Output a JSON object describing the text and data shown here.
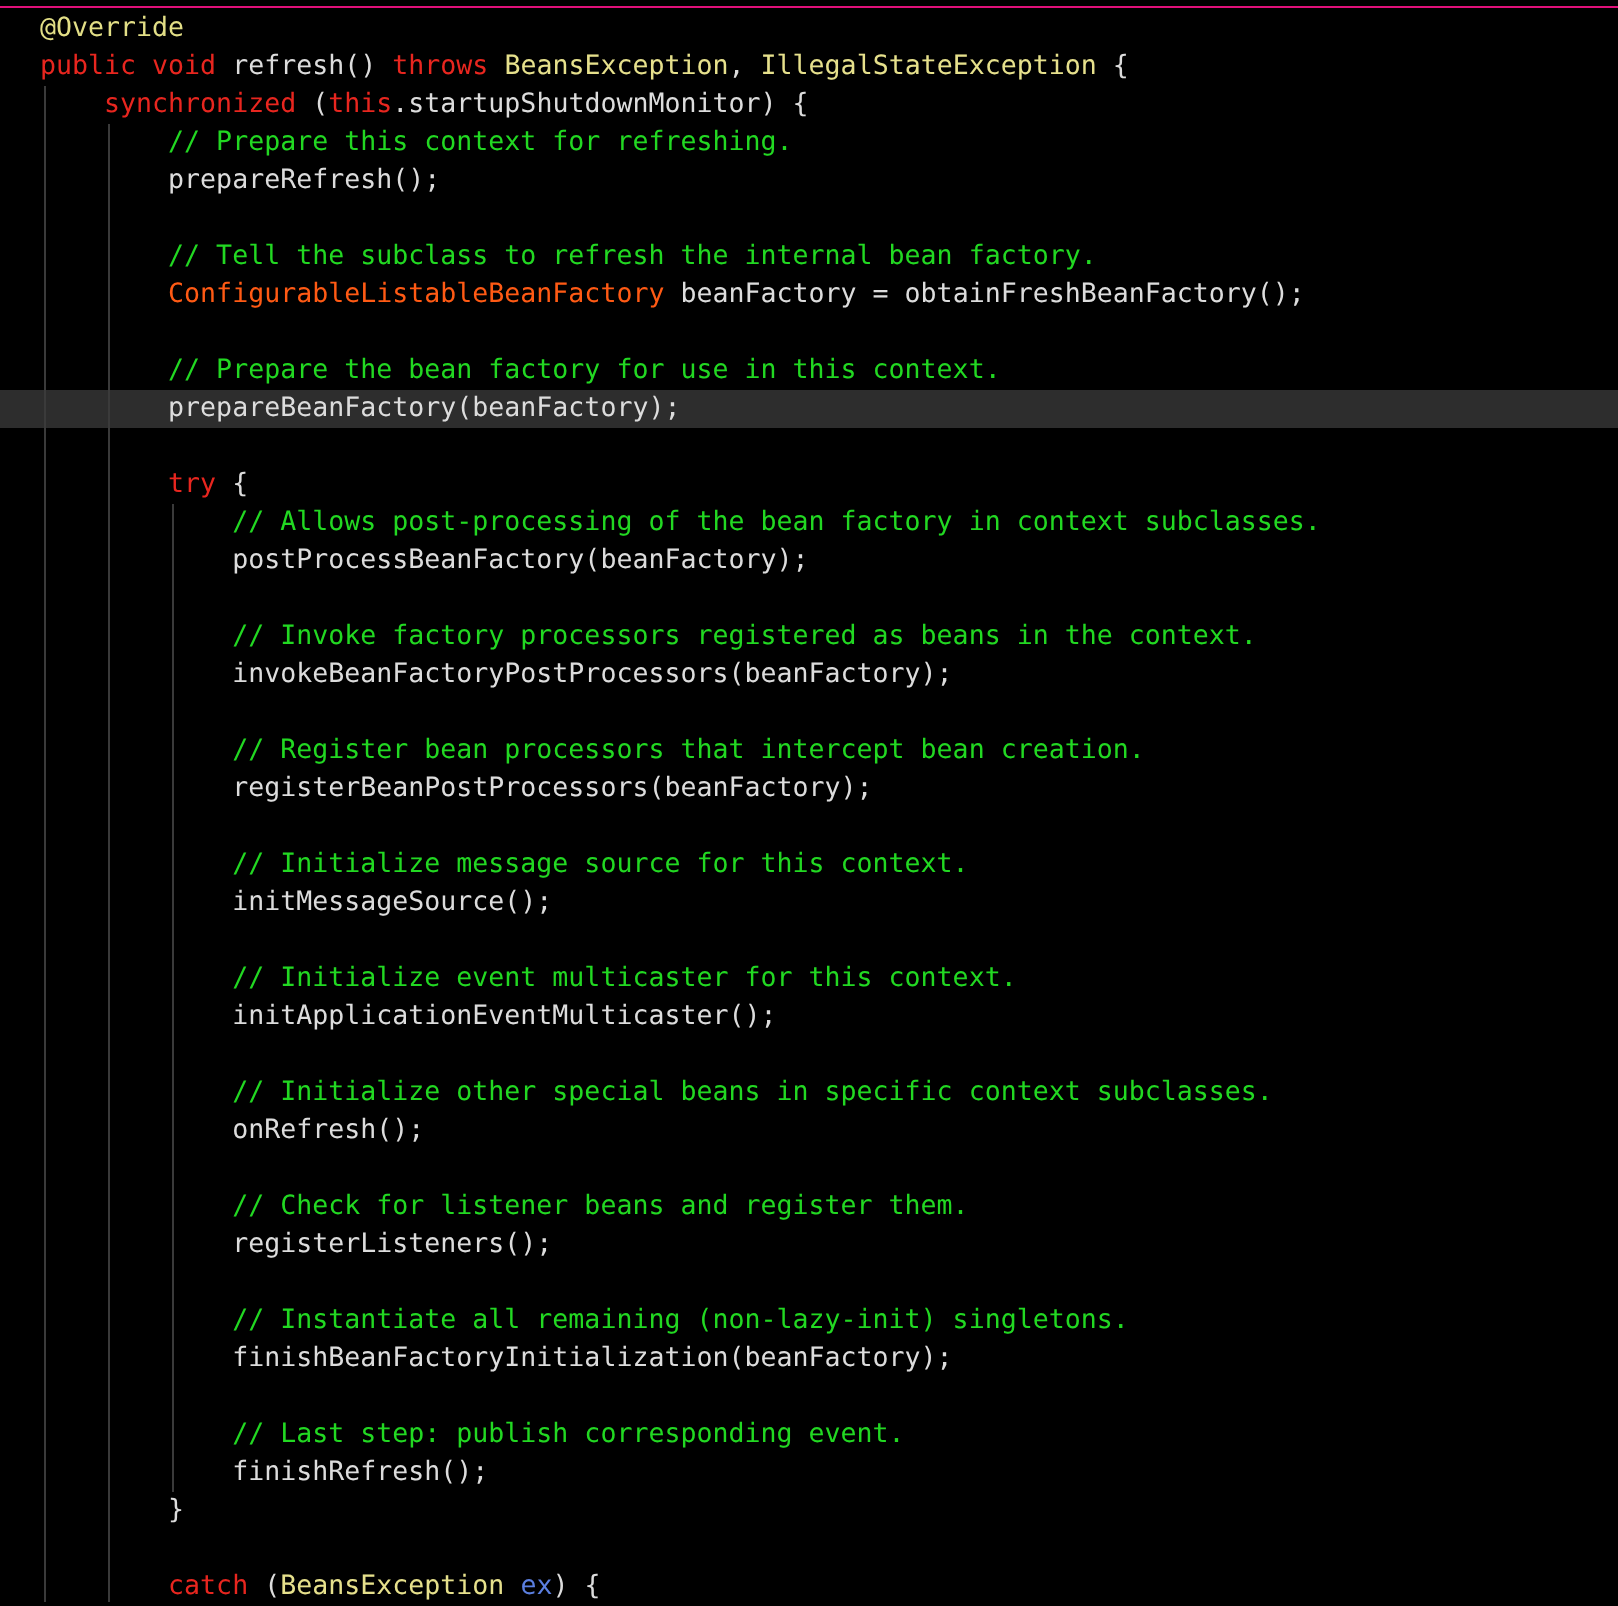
{
  "editor": {
    "lines": [
      {
        "kind": "code",
        "current": false,
        "tokens": [
          {
            "kind": "annotation",
            "text": "@Override"
          }
        ]
      },
      {
        "kind": "code",
        "current": false,
        "tokens": [
          {
            "kind": "keyword",
            "text": "public void "
          },
          {
            "kind": "plain",
            "text": "refresh() "
          },
          {
            "kind": "keyword",
            "text": "throws "
          },
          {
            "kind": "type",
            "text": "BeansException"
          },
          {
            "kind": "plain",
            "text": ", "
          },
          {
            "kind": "type",
            "text": "IllegalStateException"
          },
          {
            "kind": "plain",
            "text": " {"
          }
        ]
      },
      {
        "kind": "code",
        "current": false,
        "tokens": [
          {
            "kind": "keyword",
            "text": "    synchronized"
          },
          {
            "kind": "plain",
            "text": " ("
          },
          {
            "kind": "keyword",
            "text": "this"
          },
          {
            "kind": "plain",
            "text": ".startupShutdownMonitor) {"
          }
        ]
      },
      {
        "kind": "code",
        "current": false,
        "tokens": [
          {
            "kind": "comment",
            "text": "        // Prepare this context for refreshing."
          }
        ]
      },
      {
        "kind": "code",
        "current": false,
        "tokens": [
          {
            "kind": "plain",
            "text": "        prepareRefresh();"
          }
        ]
      },
      {
        "kind": "blank",
        "current": false
      },
      {
        "kind": "code",
        "current": false,
        "tokens": [
          {
            "kind": "comment",
            "text": "        // Tell the subclass to refresh the internal bean factory."
          }
        ]
      },
      {
        "kind": "code",
        "current": false,
        "tokens": [
          {
            "kind": "class",
            "text": "        ConfigurableListableBeanFactory"
          },
          {
            "kind": "plain",
            "text": " beanFactory = obtainFreshBeanFactory();"
          }
        ]
      },
      {
        "kind": "blank",
        "current": false
      },
      {
        "kind": "code",
        "current": false,
        "tokens": [
          {
            "kind": "comment",
            "text": "        // Prepare the bean factory for use in this context."
          }
        ]
      },
      {
        "kind": "code",
        "current": true,
        "tokens": [
          {
            "kind": "plain",
            "text": "        prepareBeanFactory(beanFactory);"
          }
        ]
      },
      {
        "kind": "blank",
        "current": false
      },
      {
        "kind": "code",
        "current": false,
        "tokens": [
          {
            "kind": "keyword",
            "text": "        try"
          },
          {
            "kind": "plain",
            "text": " {"
          }
        ]
      },
      {
        "kind": "code",
        "current": false,
        "tokens": [
          {
            "kind": "comment",
            "text": "            // Allows post-processing of the bean factory in context subclasses."
          }
        ]
      },
      {
        "kind": "code",
        "current": false,
        "tokens": [
          {
            "kind": "plain",
            "text": "            postProcessBeanFactory(beanFactory);"
          }
        ]
      },
      {
        "kind": "blank",
        "current": false
      },
      {
        "kind": "code",
        "current": false,
        "tokens": [
          {
            "kind": "comment",
            "text": "            // Invoke factory processors registered as beans in the context."
          }
        ]
      },
      {
        "kind": "code",
        "current": false,
        "tokens": [
          {
            "kind": "plain",
            "text": "            invokeBeanFactoryPostProcessors(beanFactory);"
          }
        ]
      },
      {
        "kind": "blank",
        "current": false
      },
      {
        "kind": "code",
        "current": false,
        "tokens": [
          {
            "kind": "comment",
            "text": "            // Register bean processors that intercept bean creation."
          }
        ]
      },
      {
        "kind": "code",
        "current": false,
        "tokens": [
          {
            "kind": "plain",
            "text": "            registerBeanPostProcessors(beanFactory);"
          }
        ]
      },
      {
        "kind": "blank",
        "current": false
      },
      {
        "kind": "code",
        "current": false,
        "tokens": [
          {
            "kind": "comment",
            "text": "            // Initialize message source for this context."
          }
        ]
      },
      {
        "kind": "code",
        "current": false,
        "tokens": [
          {
            "kind": "plain",
            "text": "            initMessageSource();"
          }
        ]
      },
      {
        "kind": "blank",
        "current": false
      },
      {
        "kind": "code",
        "current": false,
        "tokens": [
          {
            "kind": "comment",
            "text": "            // Initialize event multicaster for this context."
          }
        ]
      },
      {
        "kind": "code",
        "current": false,
        "tokens": [
          {
            "kind": "plain",
            "text": "            initApplicationEventMulticaster();"
          }
        ]
      },
      {
        "kind": "blank",
        "current": false
      },
      {
        "kind": "code",
        "current": false,
        "tokens": [
          {
            "kind": "comment",
            "text": "            // Initialize other special beans in specific context subclasses."
          }
        ]
      },
      {
        "kind": "code",
        "current": false,
        "tokens": [
          {
            "kind": "plain",
            "text": "            onRefresh();"
          }
        ]
      },
      {
        "kind": "blank",
        "current": false
      },
      {
        "kind": "code",
        "current": false,
        "tokens": [
          {
            "kind": "comment",
            "text": "            // Check for listener beans and register them."
          }
        ]
      },
      {
        "kind": "code",
        "current": false,
        "tokens": [
          {
            "kind": "plain",
            "text": "            registerListeners();"
          }
        ]
      },
      {
        "kind": "blank",
        "current": false
      },
      {
        "kind": "code",
        "current": false,
        "tokens": [
          {
            "kind": "comment",
            "text": "            // Instantiate all remaining (non-lazy-init) singletons."
          }
        ]
      },
      {
        "kind": "code",
        "current": false,
        "tokens": [
          {
            "kind": "plain",
            "text": "            finishBeanFactoryInitialization(beanFactory);"
          }
        ]
      },
      {
        "kind": "blank",
        "current": false
      },
      {
        "kind": "code",
        "current": false,
        "tokens": [
          {
            "kind": "comment",
            "text": "            // Last step: publish corresponding event."
          }
        ]
      },
      {
        "kind": "code",
        "current": false,
        "tokens": [
          {
            "kind": "plain",
            "text": "            finishRefresh();"
          }
        ]
      },
      {
        "kind": "code",
        "current": false,
        "tokens": [
          {
            "kind": "plain",
            "text": "        }"
          }
        ]
      },
      {
        "kind": "blank",
        "current": false
      },
      {
        "kind": "code",
        "current": false,
        "tokens": [
          {
            "kind": "keyword",
            "text": "        catch"
          },
          {
            "kind": "plain",
            "text": " ("
          },
          {
            "kind": "type",
            "text": "BeansException "
          },
          {
            "kind": "param",
            "text": "ex"
          },
          {
            "kind": "plain",
            "text": ") {"
          }
        ]
      }
    ]
  }
}
